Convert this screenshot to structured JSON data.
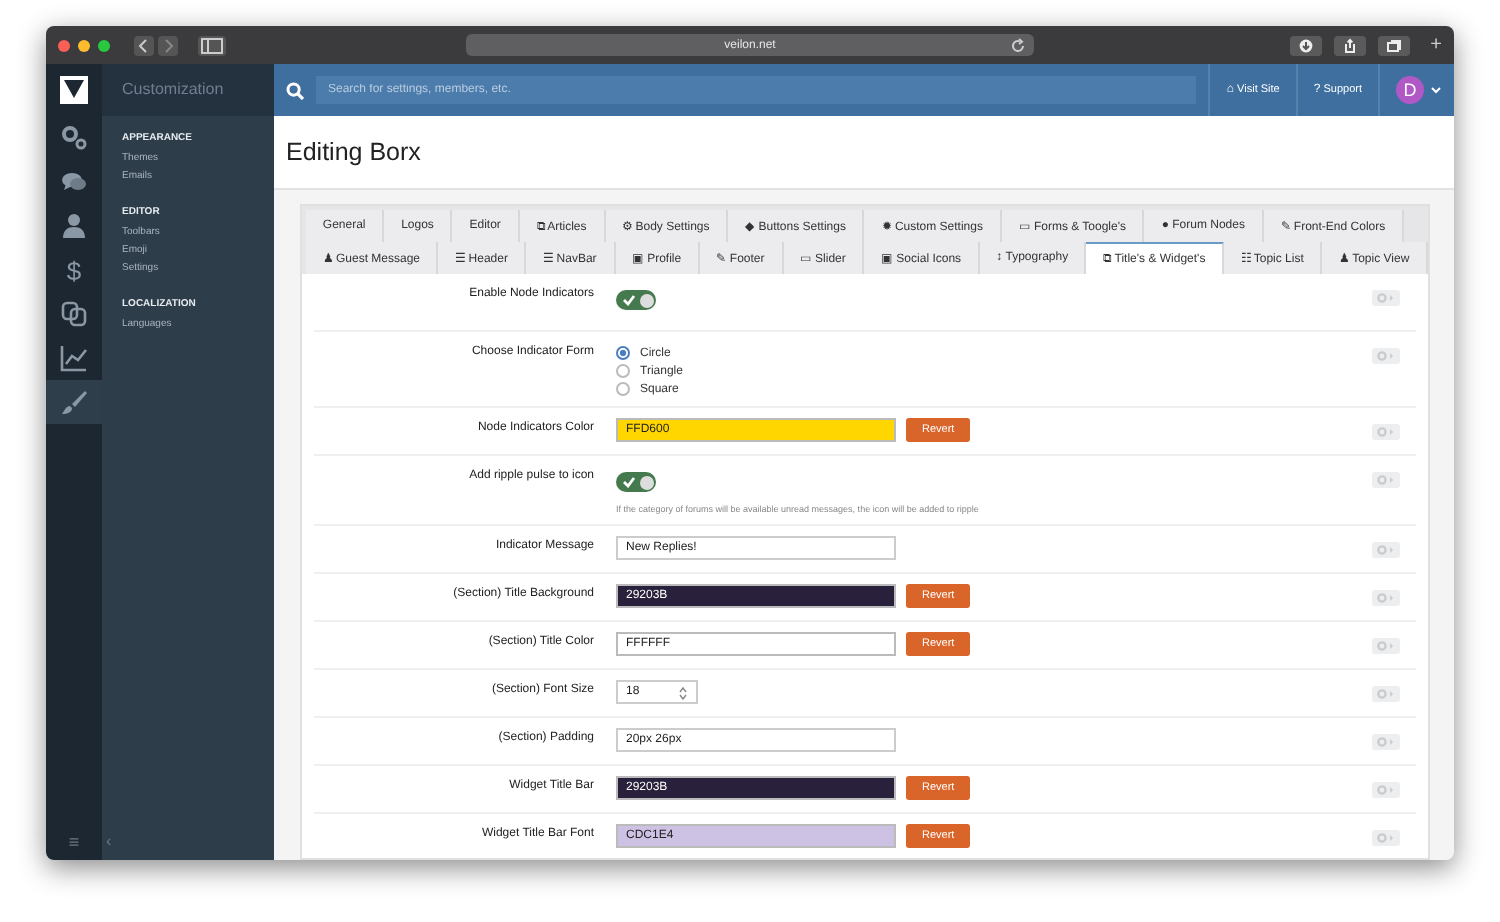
{
  "window": {
    "url": "veilon.net",
    "new_tab": "+"
  },
  "rail": [
    {
      "selected": false
    },
    {
      "selected": false
    },
    {
      "selected": false
    },
    {
      "selected": false,
      "glyph": "$"
    },
    {
      "selected": false
    },
    {
      "selected": false
    },
    {
      "selected": true
    }
  ],
  "sidebar": {
    "title": "Customization",
    "sections": [
      {
        "heading": "APPEARANCE",
        "items": [
          "Themes",
          "Emails"
        ]
      },
      {
        "heading": "EDITOR",
        "items": [
          "Toolbars",
          "Emoji",
          "Settings"
        ]
      },
      {
        "heading": "LOCALIZATION",
        "items": [
          "Languages"
        ]
      }
    ],
    "footer": {
      "menu": "≡",
      "collapse": "‹"
    }
  },
  "topbar": {
    "search_placeholder": "Search for settings, members, etc.",
    "links": [
      {
        "icon": "⌂",
        "label": "Visit Site"
      },
      {
        "icon": "?",
        "label": "Support"
      }
    ],
    "avatar": "D"
  },
  "page_title": "Editing Borx",
  "tab_rows": [
    [
      {
        "label": "General",
        "selected": false
      },
      {
        "label": "Logos",
        "selected": false
      },
      {
        "label": "Editor",
        "selected": false
      },
      {
        "icon": "⧉",
        "label": "Articles",
        "selected": false
      },
      {
        "icon": "⚙",
        "label": "Body Settings",
        "selected": false
      },
      {
        "icon": "◆",
        "label": "Buttons Settings",
        "selected": false
      },
      {
        "icon": "✹",
        "label": "Custom Settings",
        "selected": false
      },
      {
        "icon": "▭",
        "label": "Forms & Toogle's",
        "selected": false
      },
      {
        "icon": "●",
        "label": "Forum Nodes",
        "selected": false
      },
      {
        "icon": "✎",
        "label": "Front-End Colors",
        "selected": false
      }
    ],
    [
      {
        "icon": "♟",
        "label": "Guest Message",
        "selected": false
      },
      {
        "icon": "☰",
        "label": "Header",
        "selected": false
      },
      {
        "icon": "☰",
        "label": "NavBar",
        "selected": false
      },
      {
        "icon": "▣",
        "label": "Profile",
        "selected": false
      },
      {
        "icon": "✎",
        "label": "Footer",
        "selected": false
      },
      {
        "icon": "▭",
        "label": "Slider",
        "selected": false
      },
      {
        "icon": "▣",
        "label": "Social Icons",
        "selected": false
      },
      {
        "icon": "↕",
        "label": "Typography",
        "selected": false
      },
      {
        "icon": "⧉",
        "label": "Title's & Widget's",
        "selected": true
      },
      {
        "icon": "☷",
        "label": "Topic List",
        "selected": false
      },
      {
        "icon": "♟",
        "label": "Topic View",
        "selected": false
      }
    ]
  ],
  "settings": [
    {
      "kind": "toggle",
      "label": "Enable Node Indicators",
      "on": true
    },
    {
      "kind": "radio",
      "label": "Choose Indicator Form",
      "options": [
        {
          "label": "Circle",
          "selected": true
        },
        {
          "label": "Triangle",
          "selected": false
        },
        {
          "label": "Square",
          "selected": false
        }
      ]
    },
    {
      "kind": "color",
      "label": "Node Indicators Color",
      "value": "FFD600",
      "color": "#ffd600",
      "button": "Revert"
    },
    {
      "kind": "toggle",
      "label": "Add ripple pulse to icon",
      "on": true,
      "help": "If the category of forums will be available unread messages, the icon will be added to ripple"
    },
    {
      "kind": "text",
      "label": "Indicator Message",
      "value": "New Replies!"
    },
    {
      "kind": "color",
      "label": "(Section) Title Background",
      "value": "29203B",
      "color": "#29203b",
      "button": "Revert"
    },
    {
      "kind": "color",
      "label": "(Section) Title Color",
      "value": "FFFFFF",
      "color": "#ffffff",
      "button": "Revert"
    },
    {
      "kind": "number",
      "label": "(Section) Font Size",
      "value": "18"
    },
    {
      "kind": "text",
      "label": "(Section) Padding",
      "value": "20px 26px"
    },
    {
      "kind": "color",
      "label": "Widget Title Bar",
      "value": "29203B",
      "color": "#29203b",
      "button": "Revert"
    },
    {
      "kind": "color",
      "label": "Widget Title Bar Font",
      "value": "CDC1E4",
      "color": "#cdc1e4",
      "button": "Revert"
    }
  ]
}
